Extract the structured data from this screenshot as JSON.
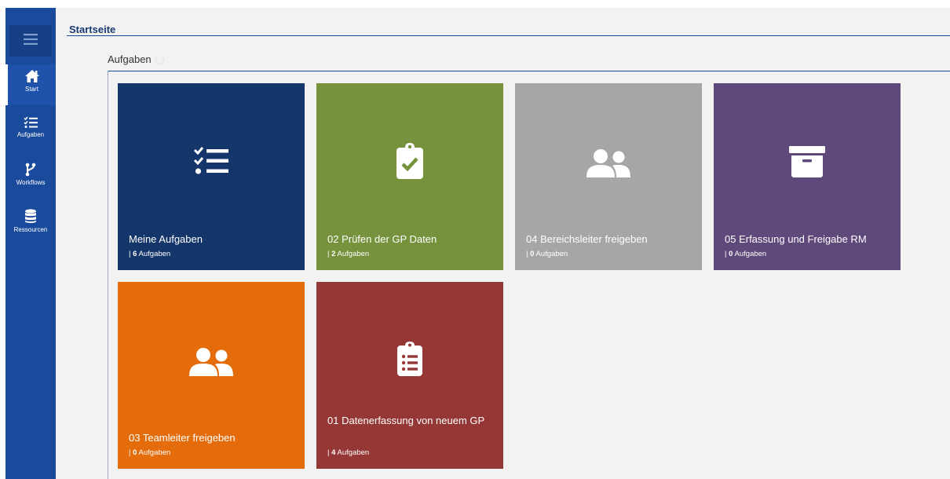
{
  "header": {
    "page_title": "Startseite",
    "section_title": "Aufgaben"
  },
  "sidebar": {
    "items": [
      {
        "label": "Start",
        "icon": "home-icon"
      },
      {
        "label": "Aufgaben",
        "icon": "tasks-icon"
      },
      {
        "label": "Workflows",
        "icon": "workflow-icon"
      },
      {
        "label": "Ressourcen",
        "icon": "database-icon"
      }
    ]
  },
  "tiles": [
    {
      "title": "Meine Aufgaben",
      "count": "6",
      "count_label": "Aufgaben",
      "color": "#15366b",
      "icon": "task-list-icon"
    },
    {
      "title": "02 Prüfen der GP Daten",
      "count": "2",
      "count_label": "Aufgaben",
      "color": "#76923c",
      "icon": "clipboard-check-icon"
    },
    {
      "title": "04 Bereichsleiter freigeben",
      "count": "0",
      "count_label": "Aufgaben",
      "color": "#a6a6a6",
      "icon": "users-icon"
    },
    {
      "title": "05 Erfassung und Freigabe RM",
      "count": "0",
      "count_label": "Aufgaben",
      "color": "#5f497a",
      "icon": "archive-icon"
    },
    {
      "title": "03 Teamleiter freigeben",
      "count": "0",
      "count_label": "Aufgaben",
      "color": "#e46c0a",
      "icon": "users-icon"
    },
    {
      "title": "01 Datenerfassung von neuem GP",
      "count": "4",
      "count_label": "Aufgaben",
      "color": "#953735",
      "icon": "clipboard-list-icon"
    }
  ],
  "colors": {
    "sidebar": "#1a4a9c",
    "background": "#f2f2f2",
    "title": "#1a3a72"
  }
}
